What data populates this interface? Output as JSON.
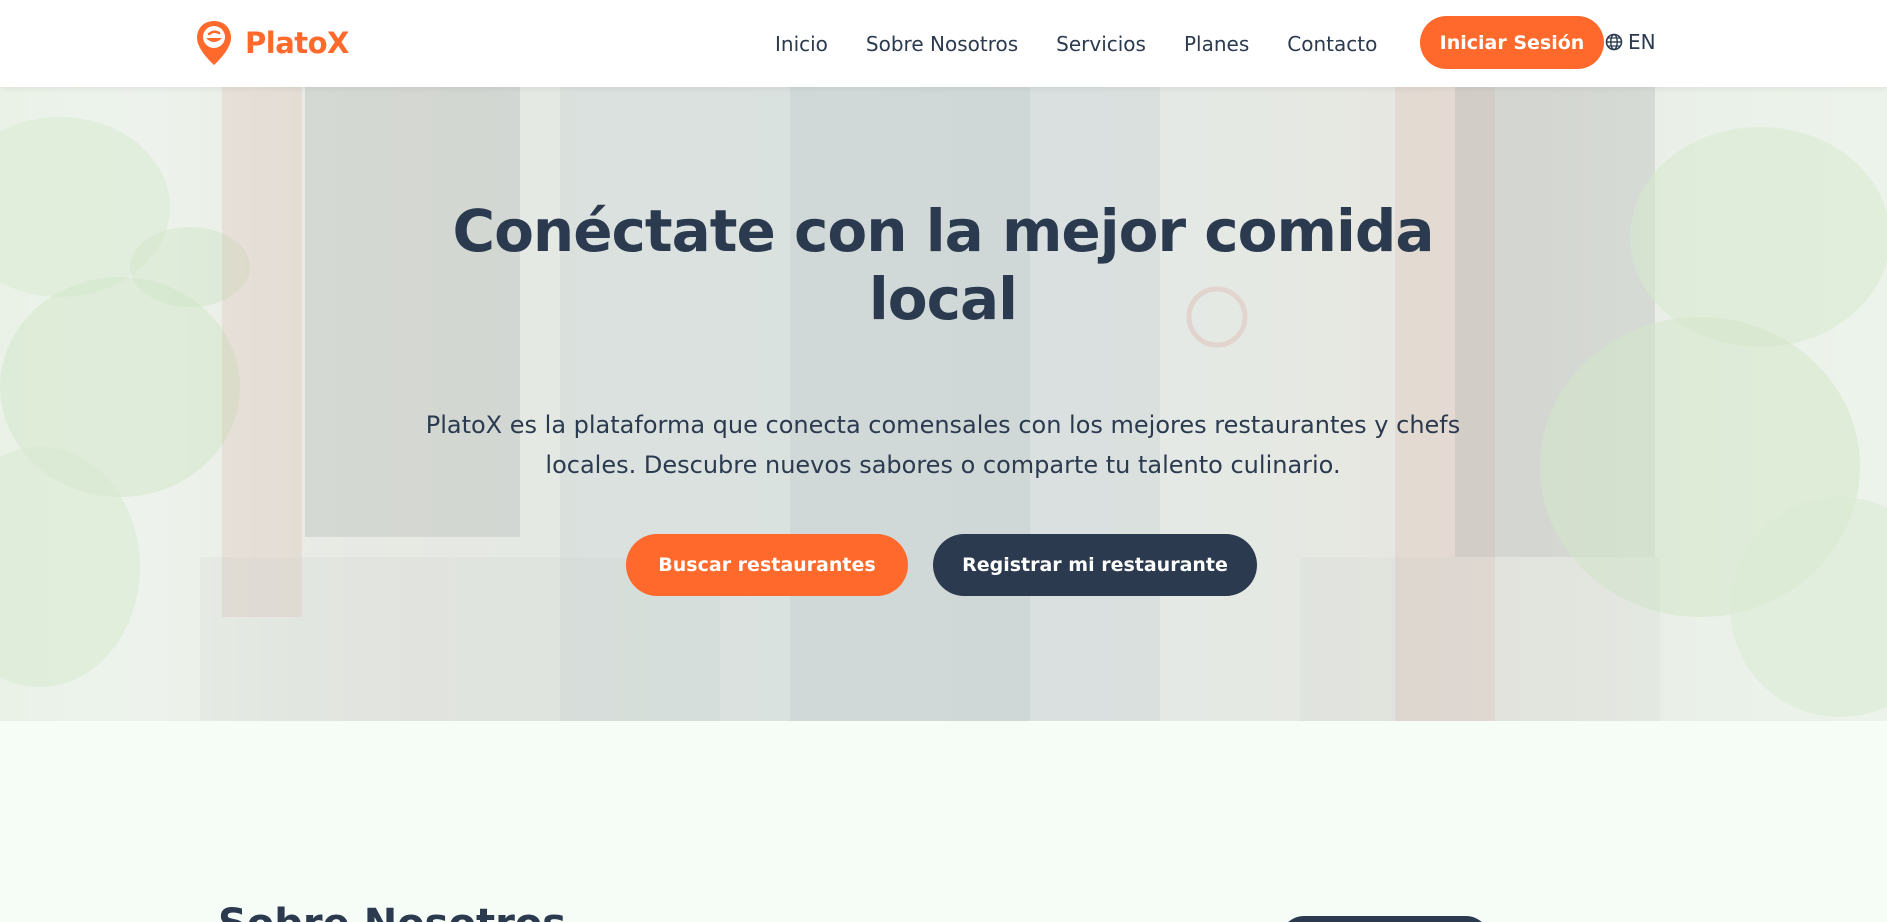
{
  "brand": {
    "name": "PlatoX",
    "logo_icon": "location-pin-dish-icon",
    "color": "#ff6a2c"
  },
  "nav": {
    "links": [
      "Inicio",
      "Sobre Nosotros",
      "Servicios",
      "Planes",
      "Contacto"
    ],
    "login_label": "Iniciar Sesión",
    "language_icon": "globe-icon",
    "language_label": "EN"
  },
  "hero": {
    "title": "Conéctate con la mejor comida local",
    "subtitle": "PlatoX es la plataforma que conecta comensales con los mejores restaurantes y chefs locales. Descubre nuevos sabores o comparte tu talento culinario.",
    "primary_cta": "Buscar restaurantes",
    "secondary_cta": "Registrar mi restaurante"
  },
  "about": {
    "heading": "Sobre Nosotros"
  },
  "colors": {
    "accent": "#ff6a2c",
    "dark": "#2b3a4f",
    "section_bg": "#f5fdf6"
  }
}
